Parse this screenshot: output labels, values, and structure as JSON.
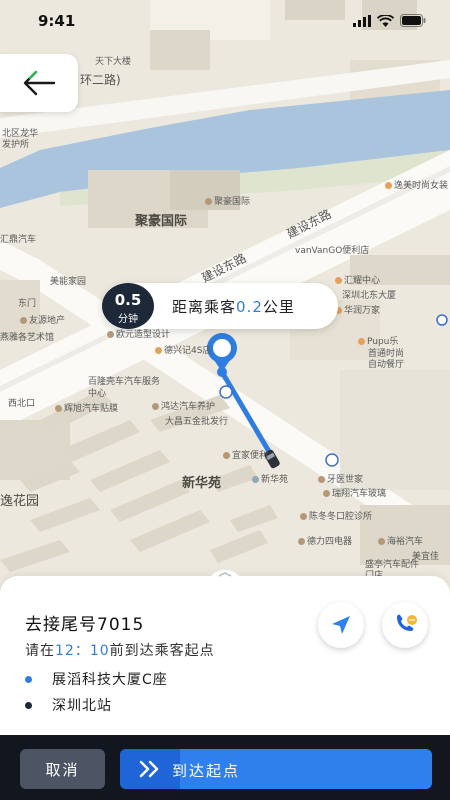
{
  "status_bar": {
    "time": "9:41",
    "icons": [
      "signal-icon",
      "wifi-icon",
      "battery-icon"
    ]
  },
  "map": {
    "labels": {
      "tianxia": "天下大楼",
      "ring_road": "环二路)",
      "longhua1": "北区龙华",
      "longhua2": "发护所",
      "juhao_poi": "聚豪国际",
      "juhao_big": "聚豪国际",
      "road_a": "建设东路",
      "road_b": "建设东路",
      "vanvango": "vanVanGO便利店",
      "huiding": "汇鼎汽车",
      "meinong": "美能家园",
      "dongmen": "东门",
      "youyuan": "友源地产",
      "yanyu": "燕雅各艺术馆",
      "ouyuan": "欧元造型设计",
      "huiyao": "汇耀中心",
      "desk": "德兴记4S店",
      "shenzhen_bei": "深圳北东大厦",
      "huarun": "华润万家",
      "pupu": "Pupu乐",
      "baijin": "首通时尚",
      "zidong": "自动餐厅",
      "pulong": "百隆壳车汽车服务中心",
      "xibei": "西北口",
      "huipai": "辉旭汽车贴膜",
      "hongda": "鸿达汽车养护",
      "dachang": "大昌五金批发行",
      "guanjia": "宜家便利",
      "xinhuayuan": "新华苑",
      "xinhuayuan_poi": "新华苑",
      "yaya": "牙医世家",
      "ruixiang": "瑞翔汽车玻璃",
      "chendong": "陈冬冬口腔诊所",
      "delisi": "德力四电器",
      "haiyu": "海裕汽车",
      "meidiao": "美宜佳",
      "shengxing": "盛亭汽车配件门店",
      "yiyuan": "逸花园",
      "yimei": "逸美时尚女装"
    }
  },
  "eta": {
    "minutes": "0.5",
    "unit": "分钟",
    "prefix": "距离乘客",
    "distance": "0.2",
    "suffix": "公里"
  },
  "order": {
    "title": "去接尾号7015",
    "sub_prefix": "请在",
    "time_h": "12",
    "sep": "：",
    "time_m": "10",
    "sub_suffix": "前到达乘客起点",
    "pickup": "展滔科技大厦C座",
    "dropoff": "深圳北站",
    "pickup_color": "#2f7de1",
    "dropoff_color": "#1d2838"
  },
  "actions": {
    "cancel": "取消",
    "arrive": "到达起点"
  },
  "colors": {
    "accent": "#2f80ed",
    "dark": "#12161f",
    "badge": "#1d2838"
  }
}
